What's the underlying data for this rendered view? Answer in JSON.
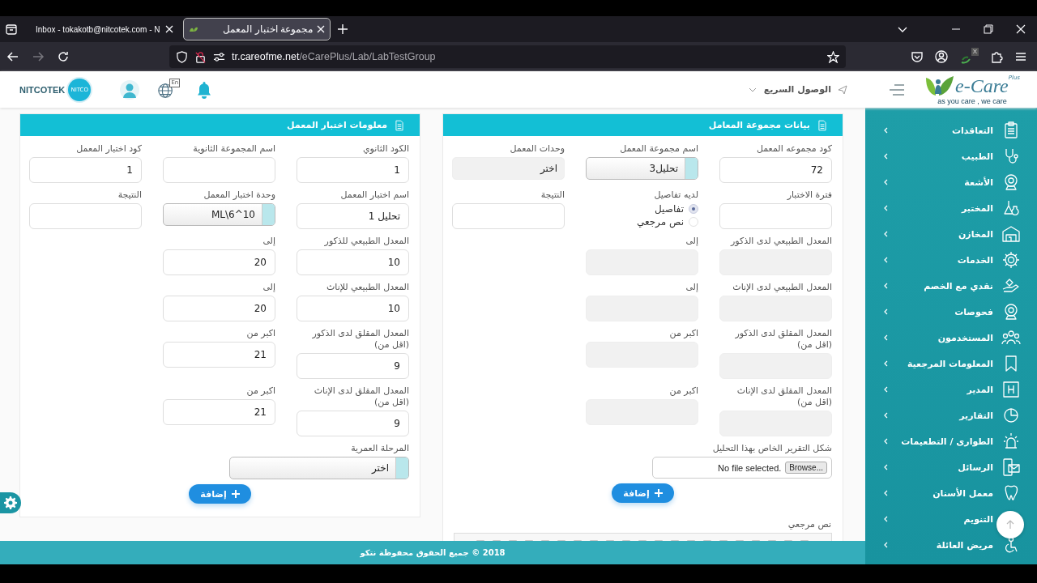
{
  "browser": {
    "mail_tab": {
      "title": "Inbox - tokakotb@nitcotek.com - N",
      "selected": false
    },
    "page_tab": {
      "title": "مجموعة اختبار المعمل",
      "selected": true
    },
    "address_bar": {
      "host": "tr.careofme.net",
      "path": "/eCarePlus/Lab/LabTestGroup"
    },
    "extension_badge": "X"
  },
  "header": {
    "company_logo": {
      "name": "NITCOTEK",
      "badge": "NITCO"
    },
    "language_badge": "En",
    "quick_access": "الوصول السريع",
    "logo": {
      "name": "e-Care",
      "suffix": "Plus",
      "tagline": "as you care , we care"
    }
  },
  "left_panel": {
    "title": "معلومات اختبار المعمل",
    "rows": [
      [
        {
          "kind": "text",
          "label": "الكود الثانوي",
          "value": "1",
          "disabled": false
        },
        {
          "kind": "text",
          "label": "اسم المجموعة الثانوية",
          "disabled": false
        },
        {
          "kind": "text",
          "label": "كود اختبار المعمل",
          "value": "1",
          "disabled": false
        }
      ],
      [
        {
          "kind": "text",
          "label": "اسم اختبار المعمل",
          "value": "تحليل 1",
          "disabled": false
        },
        {
          "kind": "select",
          "label": "وحدة اختبار المعمل",
          "value": "ML\\6^10",
          "disabled": false
        },
        {
          "kind": "text",
          "label": "النتيجة",
          "disabled": false
        }
      ],
      [
        {
          "kind": "text",
          "label": "المعدل الطبيعي للذكور",
          "value": "10",
          "disabled": false
        },
        {
          "kind": "text",
          "label": "إلى",
          "value": "20",
          "disabled": false
        }
      ],
      [
        {
          "kind": "text",
          "label": "المعدل الطبيعي للإناث",
          "value": "10",
          "disabled": false
        },
        {
          "kind": "text",
          "label": "إلى",
          "value": "20",
          "disabled": false
        }
      ],
      [
        {
          "kind": "text",
          "label": "المعدل المقلق لدى الذكور (اقل من)",
          "value": "9",
          "disabled": false
        },
        {
          "kind": "text",
          "label": "اكبر من",
          "value": "21",
          "disabled": false
        }
      ],
      [
        {
          "kind": "text",
          "label": "المعدل المقلق لدى الإناث (اقل من)",
          "value": "9",
          "disabled": false
        },
        {
          "kind": "text",
          "label": "اكبر من",
          "value": "21",
          "disabled": false
        }
      ],
      [
        {
          "kind": "select",
          "label": "المرحلة العمرية",
          "value": "اختر",
          "disabled": false
        }
      ]
    ],
    "add_button": "إضافة"
  },
  "right_panel": {
    "title": "بيانات مجموعة المعامل",
    "rows": [
      [
        {
          "kind": "text",
          "label": "كود مجموعه المعمل",
          "value": "72",
          "disabled": false
        },
        {
          "kind": "select",
          "label": "اسم مجموعة المعمل",
          "value": "تحليل3",
          "disabled": false
        },
        {
          "kind": "select",
          "label": "وحدات المعمل",
          "value": "اختر",
          "disabled": true
        }
      ],
      [
        {
          "kind": "text",
          "label": "فترة الاختبار",
          "disabled": false
        },
        {
          "kind": "radio",
          "label": "لديه تفاصيل",
          "options": [
            {
              "label": "تفاصيل",
              "selected": true
            },
            {
              "label": "نص مرجعي",
              "selected": false
            }
          ]
        },
        {
          "kind": "text",
          "label": "النتيجة",
          "disabled": false
        }
      ],
      [
        {
          "kind": "text",
          "label": "المعدل الطبيعي لدى الذكور",
          "disabled": true
        },
        {
          "kind": "text",
          "label": "إلى",
          "disabled": true
        }
      ],
      [
        {
          "kind": "text",
          "label": "المعدل الطبيعي لدى الإناث",
          "disabled": true
        },
        {
          "kind": "text",
          "label": "إلى",
          "disabled": true
        }
      ],
      [
        {
          "kind": "text",
          "label": "المعدل المقلق لدى الذكور (اقل من)",
          "disabled": true
        },
        {
          "kind": "text",
          "label": "اكبر من",
          "disabled": true
        }
      ],
      [
        {
          "kind": "text",
          "label": "المعدل المقلق لدى الإناث (اقل من)",
          "disabled": true
        },
        {
          "kind": "text",
          "label": "اكبر من",
          "disabled": true
        }
      ],
      [
        {
          "kind": "file",
          "label": "شكل التقرير الخاص بهذا التحليل",
          "button": "Browse...",
          "status": "No file selected."
        }
      ]
    ],
    "add_button": "إضافة",
    "reference_label": "نص مرجعي"
  },
  "sidebar": {
    "items": [
      "التعاقدات",
      "الطبيب",
      "الأشعة",
      "المختبر",
      "المخازن",
      "الخدمات",
      "نقدي مع الخصم",
      "فحوصات",
      "المستخدمون",
      "المعلومات المرجعية",
      "المدير",
      "التقارير",
      "الطوارى / التطعيمات",
      "الرسائل",
      "معمل الأسنان",
      "التنويم",
      "مريض العائلة"
    ]
  },
  "footer": "2018 © جميع الحقوق محفوظة نتكو"
}
